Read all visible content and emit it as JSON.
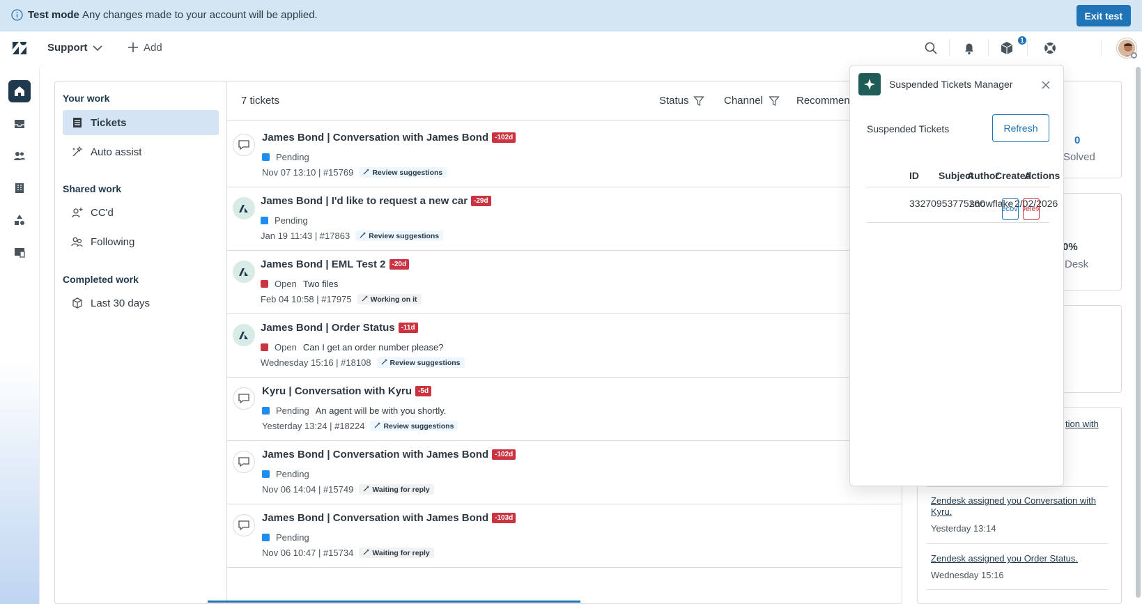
{
  "banner": {
    "title": "Test mode",
    "message": "Any changes made to your account will be applied.",
    "exit_label": "Exit test"
  },
  "topnav": {
    "product": "Support",
    "add_label": "Add",
    "notification_count": "1"
  },
  "views": {
    "your_work_heading": "Your work",
    "your_work": [
      {
        "label": "Tickets",
        "icon": "inbox-icon"
      },
      {
        "label": "Auto assist",
        "icon": "auto-assist-icon"
      }
    ],
    "shared_work_heading": "Shared work",
    "shared_work": [
      {
        "label": "CC'd",
        "icon": "user-plus-icon"
      },
      {
        "label": "Following",
        "icon": "users-icon"
      }
    ],
    "completed_work_heading": "Completed work",
    "completed_work": [
      {
        "label": "Last 30 days",
        "icon": "box-icon"
      }
    ]
  },
  "ticket_list": {
    "count_label": "7 tickets",
    "filters": [
      "Status",
      "Channel",
      "Recommen"
    ],
    "tickets": [
      {
        "channel": "chat",
        "subject": "James Bond | Conversation with James Bond",
        "due": "-102d",
        "status": "Pending",
        "preview": "",
        "meta": "Nov 07 13:10 | #15769",
        "tag": "Review suggestions",
        "tag_style": "blue"
      },
      {
        "channel": "zendesk",
        "subject": "James Bond | I'd like to request a new car",
        "due": "-29d",
        "status": "Pending",
        "preview": "",
        "meta": "Jan 19 11:43 | #17863",
        "tag": "Review suggestions",
        "tag_style": "blue"
      },
      {
        "channel": "zendesk",
        "subject": "James Bond | EML Test 2",
        "due": "-20d",
        "status": "Open",
        "preview": "Two files",
        "meta": "Feb 04 10:58 | #17975",
        "tag": "Working on it",
        "tag_style": "grey"
      },
      {
        "channel": "zendesk",
        "subject": "James Bond | Order Status",
        "due": "-11d",
        "status": "Open",
        "preview": "Can I get an order number please?",
        "meta": "Wednesday 15:16 | #18108",
        "tag": "Review suggestions",
        "tag_style": "blue"
      },
      {
        "channel": "chat",
        "subject": "Kyru | Conversation with Kyru",
        "due": "-5d",
        "status": "Pending",
        "preview": "An agent will be with you shortly.",
        "meta": "Yesterday 13:24 | #18224",
        "tag": "Review suggestions",
        "tag_style": "blue"
      },
      {
        "channel": "chat",
        "subject": "James Bond | Conversation with James Bond",
        "due": "-102d",
        "status": "Pending",
        "preview": "",
        "meta": "Nov 06 14:04 | #15749",
        "tag": "Waiting for reply",
        "tag_style": "grey"
      },
      {
        "channel": "chat",
        "subject": "James Bond | Conversation with James Bond",
        "due": "-103d",
        "status": "Pending",
        "preview": "",
        "meta": "Nov 06 10:47 | #15734",
        "tag": "Waiting for reply",
        "tag_style": "grey"
      }
    ]
  },
  "status_colors": {
    "Pending": "#1f8ded",
    "Open": "#cc3340"
  },
  "right_panel": {
    "solved_count": "0",
    "solved_label": "Solved",
    "pct_fragment": "0%",
    "desk_fragment": "Desk",
    "activity_fragment": "tion with",
    "activity": [
      {
        "link": "Zendesk assigned you Conversation with Kyru.",
        "time": "Yesterday 13:14"
      },
      {
        "link": "Zendesk assigned you Order Status.",
        "time": "Wednesday 15:16"
      }
    ]
  },
  "popup": {
    "title": "Suspended Tickets Manager",
    "subtitle": "Suspended Tickets",
    "refresh_label": "Refresh",
    "columns": [
      "ID",
      "Subject",
      "Author",
      "Created",
      "Actions"
    ],
    "row": {
      "id": "33270953775260",
      "author": "snowflake",
      "created": "2/02/2026",
      "recover_label": "Recover",
      "delete_label": "Delete"
    }
  }
}
